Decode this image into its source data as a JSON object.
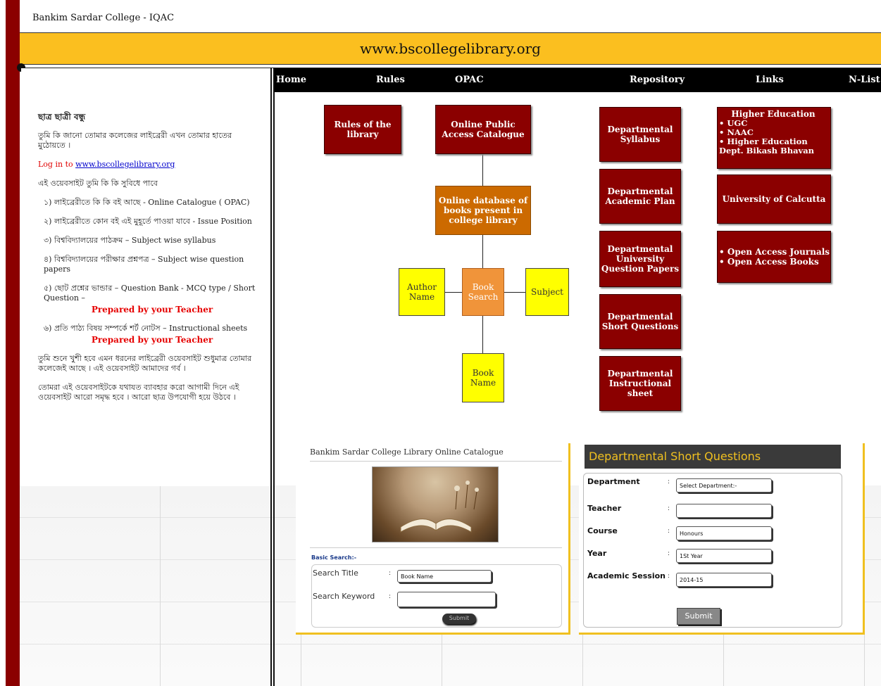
{
  "page": {
    "title": "Bankim Sardar College - IQAC",
    "banner": "www.bscollegelibrary.org"
  },
  "nav": {
    "home": "Home",
    "rules": "Rules",
    "opac": "OPAC",
    "repository": "Repository",
    "links": "Links",
    "nlist": "N-List"
  },
  "left": {
    "heading": "ছাত্র ছাত্রী বন্ধু",
    "intro": "তুমি কি জানো তোমার কলেজের লাইব্রেরী এখন তোমার হাতের মুঠোয়তে ।",
    "login_prefix": "Log in to ",
    "login_link": "www.bscollegelibrary.org",
    "benefits": "এই ওয়েবসাইট তুমি কি কি সুবিধে পাবে",
    "item1": "১) লাইব্রেরীতে কি কি বই আছে - Online Catalogue ( OPAC)",
    "item2": "২) লাইব্রেরীতে কোন বই এই মুহূর্তে পাওয়া যাবে - Issue Position",
    "item3": "৩) বিশ্ববিদ্যালয়ের পাঠক্রম – Subject wise syllabus",
    "item4": "৪) বিশ্ববিদ্যালয়ের পরীক্ষার প্রশ্নপত্র – Subject wise question papers",
    "item5": "৫) ছোট প্রশ্নের ভান্ডার – Question Bank - MCQ type / Short Question –",
    "prepared1": "Prepared by your Teacher",
    "item6": "৬) প্রতি পাঠ্য বিষয় সম্পর্কে শর্ট নোটস – Instructional sheets",
    "prepared2": "Prepared by your Teacher",
    "para1": "তুমি শুনে খুশী হবে এমন ধরনের লাইব্রেরী ওয়েবসাইট শুধুমাত্র তোমার কলেজেই আছে । এই ওয়েবসাইট আমাদের গর্ব ।",
    "para2": "তোমরা এই ওয়েবসাইটকে যথাযত ব্যাবহার করো আগামী দিনে এই ওয়েবসাইট আরো সমৃদ্ধ হবে । আরো ছাত্র উপযোগী হয়ে উঠবে ।"
  },
  "diagram": {
    "rules": "Rules of the library",
    "opac": "Online Public Access Catalogue",
    "database": "Online database of books present in college library",
    "author": "Author Name",
    "booksearch": "Book Search",
    "subject": "Subject",
    "bookname": "Book Name"
  },
  "repository": {
    "syllabus": "Departmental Syllabus",
    "academic": "Departmental Academic Plan",
    "question_papers": "Departmental University Question Papers",
    "short_q": "Departmental Short Questions",
    "instructional": "Departmental Instructional sheet"
  },
  "links": {
    "he_title": "Higher Education",
    "ugc": "UGC",
    "naac": "NAAC",
    "hed": "Higher Education Dept. Bikash Bhavan",
    "cu": "University of Calcutta",
    "oaj": "Open Access Journals",
    "oab": "Open Access Books"
  },
  "catalogue": {
    "title": "Bankim Sardar College Library Online Catalogue",
    "basic": "Basic Search:-",
    "search_title_label": "Search Title",
    "search_title_value": "Book Name",
    "search_keyword_label": "Search Keyword",
    "search_keyword_value": "",
    "colon": ":",
    "submit": "Submit"
  },
  "dsq": {
    "heading": "Departmental Short Questions",
    "department_label": "Department",
    "department_value": "Select Department:-",
    "teacher_label": "Teacher",
    "teacher_value": "",
    "course_label": "Course",
    "course_value": "Honours",
    "year_label": "Year",
    "year_value": "1St Year",
    "session_label": "Academic Session",
    "session_value": "2014-15",
    "colon": ":",
    "submit": "Submit"
  }
}
